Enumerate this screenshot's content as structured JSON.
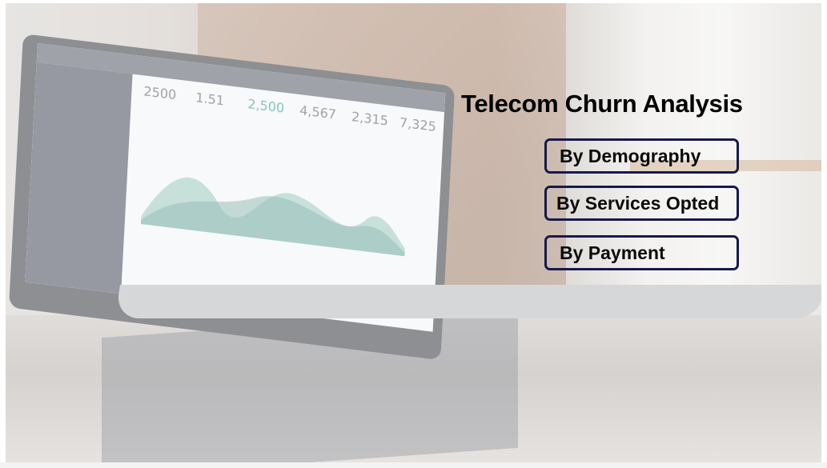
{
  "slide": {
    "title": "Telecom Churn Analysis",
    "nav_buttons": [
      {
        "label": "By Demography"
      },
      {
        "label": "By Services Opted"
      },
      {
        "label": "By Payment"
      }
    ],
    "colors": {
      "title": "#000000",
      "button_border": "#161a4a",
      "button_text": "#0b0b0b"
    }
  },
  "background_image": {
    "subject": "laptop-dashboard-photo",
    "screen_stats": [
      "2500",
      "1.51",
      "2,500",
      "4,567",
      "2,315",
      "7,325"
    ]
  }
}
